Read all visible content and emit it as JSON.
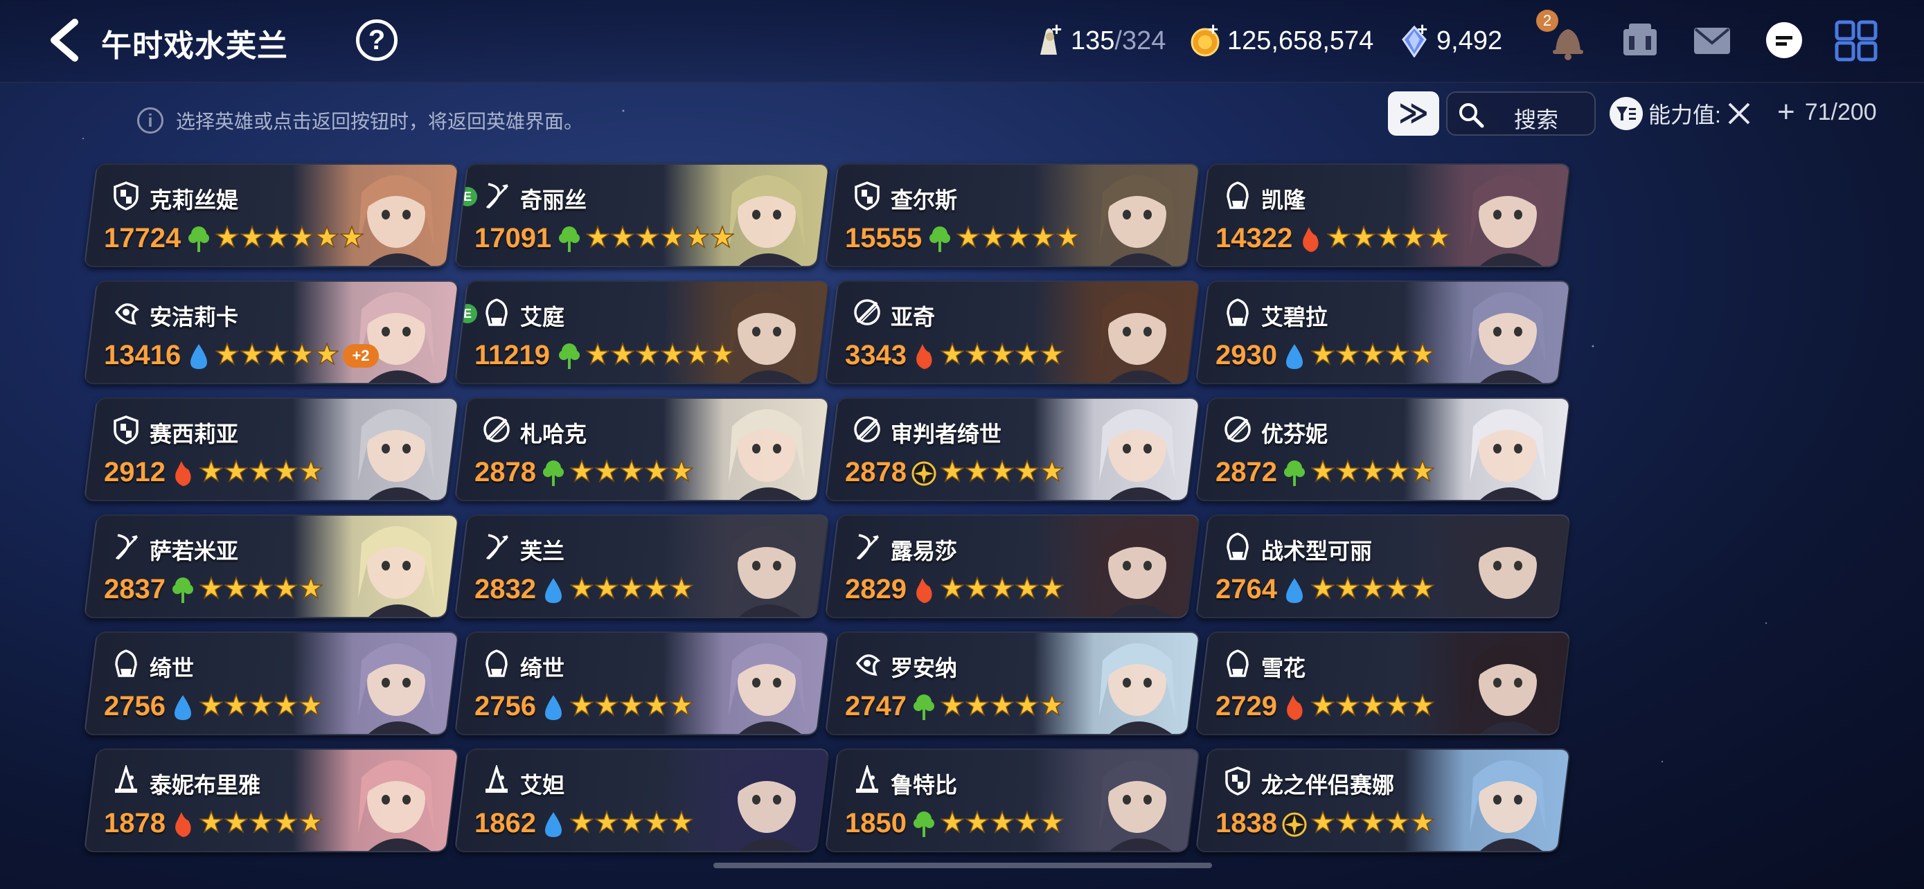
{
  "header": {
    "title": "午时戏水芙兰",
    "help_label": "?",
    "resources": {
      "stamina": {
        "current": "135",
        "max": "/324",
        "icon": "stamina-icon"
      },
      "gold": {
        "value": "125,658,574",
        "icon": "gold-coin-icon"
      },
      "crystal": {
        "value": "9,492",
        "icon": "crystal-icon"
      }
    },
    "notification_count": "2"
  },
  "toolbar": {
    "hint": "选择英雄或点击返回按钮时，将返回英雄界面。",
    "fast_forward": "≫",
    "search_label": "搜索",
    "sort_label": "能力值:",
    "hero_count": "71/200"
  },
  "heroes": [
    {
      "name": "克莉丝媞",
      "power": "17724",
      "role": "knight",
      "element": "earth",
      "stars": 6,
      "plus": "",
      "e": false
    },
    {
      "name": "奇丽丝",
      "power": "17091",
      "role": "ranger",
      "element": "earth",
      "stars": 6,
      "plus": "",
      "e": true
    },
    {
      "name": "查尔斯",
      "power": "15555",
      "role": "knight",
      "element": "earth",
      "stars": 5,
      "plus": "",
      "e": false
    },
    {
      "name": "凯隆",
      "power": "14322",
      "role": "assassin",
      "element": "fire",
      "stars": 5,
      "plus": "",
      "e": false
    },
    {
      "name": "安洁莉卡",
      "power": "13416",
      "role": "healer",
      "element": "water",
      "stars": 5,
      "plus": "+2",
      "e": false
    },
    {
      "name": "艾庭",
      "power": "11219",
      "role": "assassin",
      "element": "earth",
      "stars": 6,
      "plus": "",
      "e": true
    },
    {
      "name": "亚奇",
      "power": "3343",
      "role": "warrior",
      "element": "fire",
      "stars": 5,
      "plus": "",
      "e": false
    },
    {
      "name": "艾碧拉",
      "power": "2930",
      "role": "assassin",
      "element": "water",
      "stars": 5,
      "plus": "",
      "e": false
    },
    {
      "name": "赛西莉亚",
      "power": "2912",
      "role": "knight",
      "element": "fire",
      "stars": 5,
      "plus": "",
      "e": false
    },
    {
      "name": "札哈克",
      "power": "2878",
      "role": "warrior",
      "element": "earth",
      "stars": 5,
      "plus": "",
      "e": false
    },
    {
      "name": "审判者绮世",
      "power": "2878",
      "role": "warrior",
      "element": "light",
      "stars": 5,
      "plus": "",
      "e": false
    },
    {
      "name": "优芬妮",
      "power": "2872",
      "role": "warrior",
      "element": "earth",
      "stars": 5,
      "plus": "",
      "e": false
    },
    {
      "name": "萨若米亚",
      "power": "2837",
      "role": "ranger",
      "element": "earth",
      "stars": 5,
      "plus": "",
      "e": false
    },
    {
      "name": "芙兰",
      "power": "2832",
      "role": "ranger",
      "element": "water",
      "stars": 5,
      "plus": "",
      "e": false
    },
    {
      "name": "露易莎",
      "power": "2829",
      "role": "ranger",
      "element": "fire",
      "stars": 5,
      "plus": "",
      "e": false
    },
    {
      "name": "战术型可丽",
      "power": "2764",
      "role": "assassin",
      "element": "water",
      "stars": 5,
      "plus": "",
      "e": false
    },
    {
      "name": "绮世",
      "power": "2756",
      "role": "assassin",
      "element": "water",
      "stars": 5,
      "plus": "",
      "e": false
    },
    {
      "name": "绮世",
      "power": "2756",
      "role": "assassin",
      "element": "water",
      "stars": 5,
      "plus": "",
      "e": false
    },
    {
      "name": "罗安纳",
      "power": "2747",
      "role": "healer",
      "element": "earth",
      "stars": 5,
      "plus": "",
      "e": false
    },
    {
      "name": "雪花",
      "power": "2729",
      "role": "assassin",
      "element": "fire",
      "stars": 5,
      "plus": "",
      "e": false
    },
    {
      "name": "泰妮布里雅",
      "power": "1878",
      "role": "mage",
      "element": "fire",
      "stars": 5,
      "plus": "",
      "e": false
    },
    {
      "name": "艾妲",
      "power": "1862",
      "role": "mage",
      "element": "water",
      "stars": 5,
      "plus": "",
      "e": false
    },
    {
      "name": "鲁特比",
      "power": "1850",
      "role": "mage",
      "element": "earth",
      "stars": 5,
      "plus": "",
      "e": false
    },
    {
      "name": "龙之伴侣赛娜",
      "power": "1838",
      "role": "knight",
      "element": "light",
      "stars": 5,
      "plus": "",
      "e": false
    }
  ],
  "colors": {
    "power": "#ffa23c",
    "star": "#ffc83a",
    "earth": "#5cc23a",
    "fire": "#f0502a",
    "water": "#3a9cf0",
    "light": "#f2c23a"
  }
}
